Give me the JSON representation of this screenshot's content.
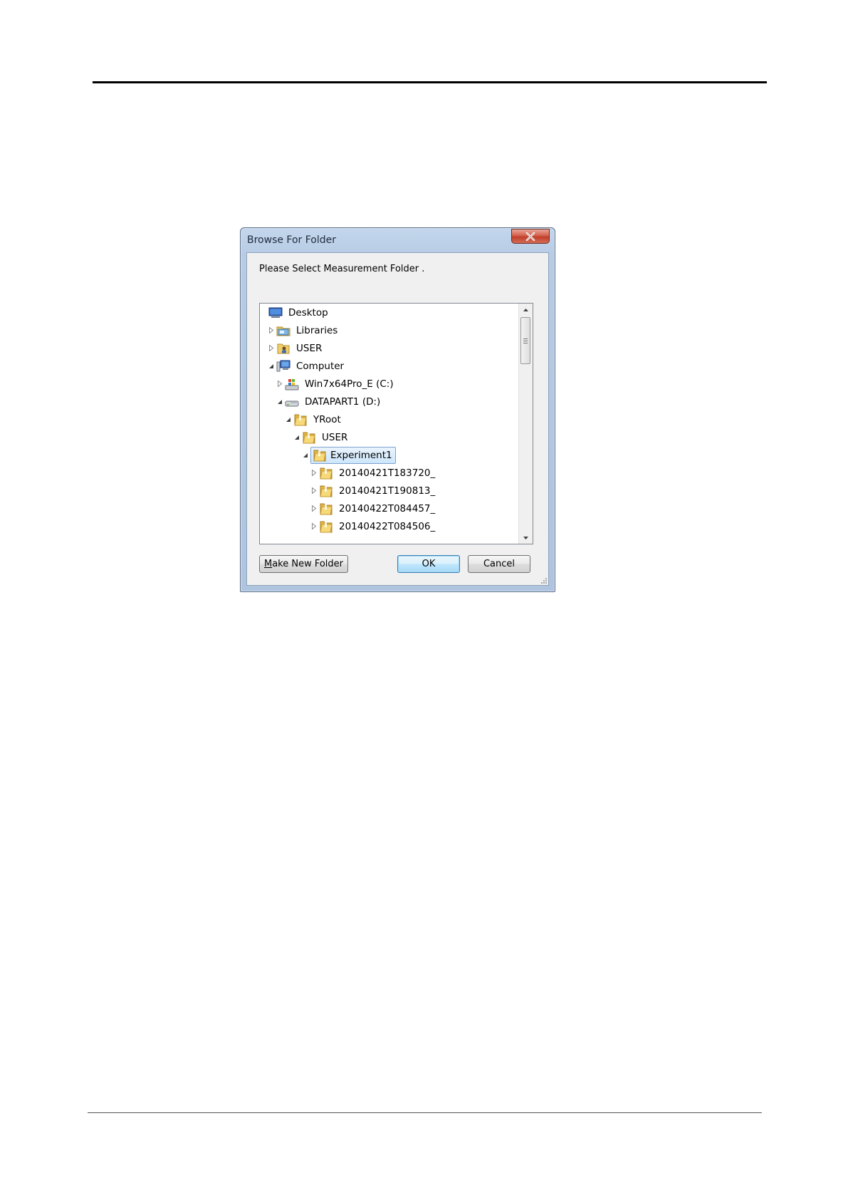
{
  "dialog": {
    "title": "Browse For Folder",
    "prompt": "Please Select Measurement Folder .",
    "tree": [
      {
        "label": "Desktop",
        "level": 0,
        "expander": "none",
        "icon": "desktop-icon"
      },
      {
        "label": "Libraries",
        "level": 1,
        "expander": "collapsed",
        "icon": "libraries-icon"
      },
      {
        "label": "USER",
        "level": 1,
        "expander": "collapsed",
        "icon": "user-folder-icon"
      },
      {
        "label": "Computer",
        "level": 1,
        "expander": "expanded",
        "icon": "computer-icon"
      },
      {
        "label": "Win7x64Pro_E (C:)",
        "level": 2,
        "expander": "collapsed",
        "icon": "system-drive-icon"
      },
      {
        "label": "DATAPART1 (D:)",
        "level": 2,
        "expander": "expanded",
        "icon": "drive-icon"
      },
      {
        "label": "YRoot",
        "level": 3,
        "expander": "expanded",
        "icon": "folder-icon"
      },
      {
        "label": "USER",
        "level": 4,
        "expander": "expanded",
        "icon": "folder-icon"
      },
      {
        "label": "Experiment1",
        "level": 5,
        "expander": "expanded",
        "icon": "folder-icon",
        "selected": true
      },
      {
        "label": "20140421T183720_",
        "level": 6,
        "expander": "collapsed",
        "icon": "folder-icon"
      },
      {
        "label": "20140421T190813_",
        "level": 6,
        "expander": "collapsed",
        "icon": "folder-icon"
      },
      {
        "label": "20140422T084457_",
        "level": 6,
        "expander": "collapsed",
        "icon": "folder-icon"
      },
      {
        "label": "20140422T084506_",
        "level": 6,
        "expander": "collapsed",
        "icon": "folder-icon"
      }
    ],
    "buttons": {
      "make_new_folder": "Make New Folder",
      "make_new_folder_mnemonic": "M",
      "make_new_folder_rest": "ake New Folder",
      "ok": "OK",
      "cancel": "Cancel"
    }
  },
  "colors": {
    "frame": "#b6cbe4",
    "close_button": "#c7462f",
    "selection": "#cde6fb"
  }
}
